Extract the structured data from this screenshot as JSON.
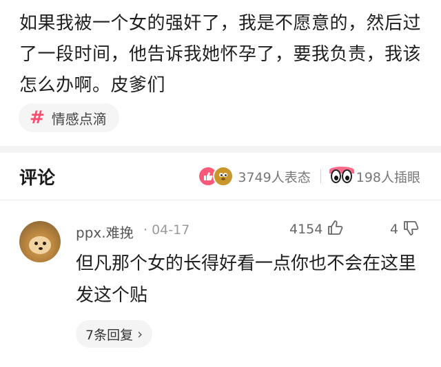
{
  "post": {
    "text": "如果我被一个女的强奸了，我是不愿意的，然后过了一段时间，他告诉我她怀孕了，要我负责，我该怎么办啊。皮爹们",
    "topic": {
      "icon": "hash-icon",
      "label": "情感点滴"
    }
  },
  "comments_section": {
    "title": "评论",
    "reactions": {
      "icons": [
        "thumbs-up-emoji-icon",
        "mole-emoji-icon"
      ],
      "label": "3749人表态"
    },
    "insert_eyes": {
      "icon": "eyes-emoji-icon",
      "label": "198人插眼"
    }
  },
  "comment": {
    "user": "ppx.难挽",
    "date": "· 04-17",
    "likes": "4154",
    "dislikes": "4",
    "text": "但凡那个女的长得好看一点你也不会在这里发这个贴",
    "replies": {
      "label": "7条回复",
      "chevron": "›"
    }
  },
  "colors": {
    "accent": "#ff4d6d",
    "muted": "#9a9a9a",
    "chip_bg": "#f5f5f5"
  }
}
